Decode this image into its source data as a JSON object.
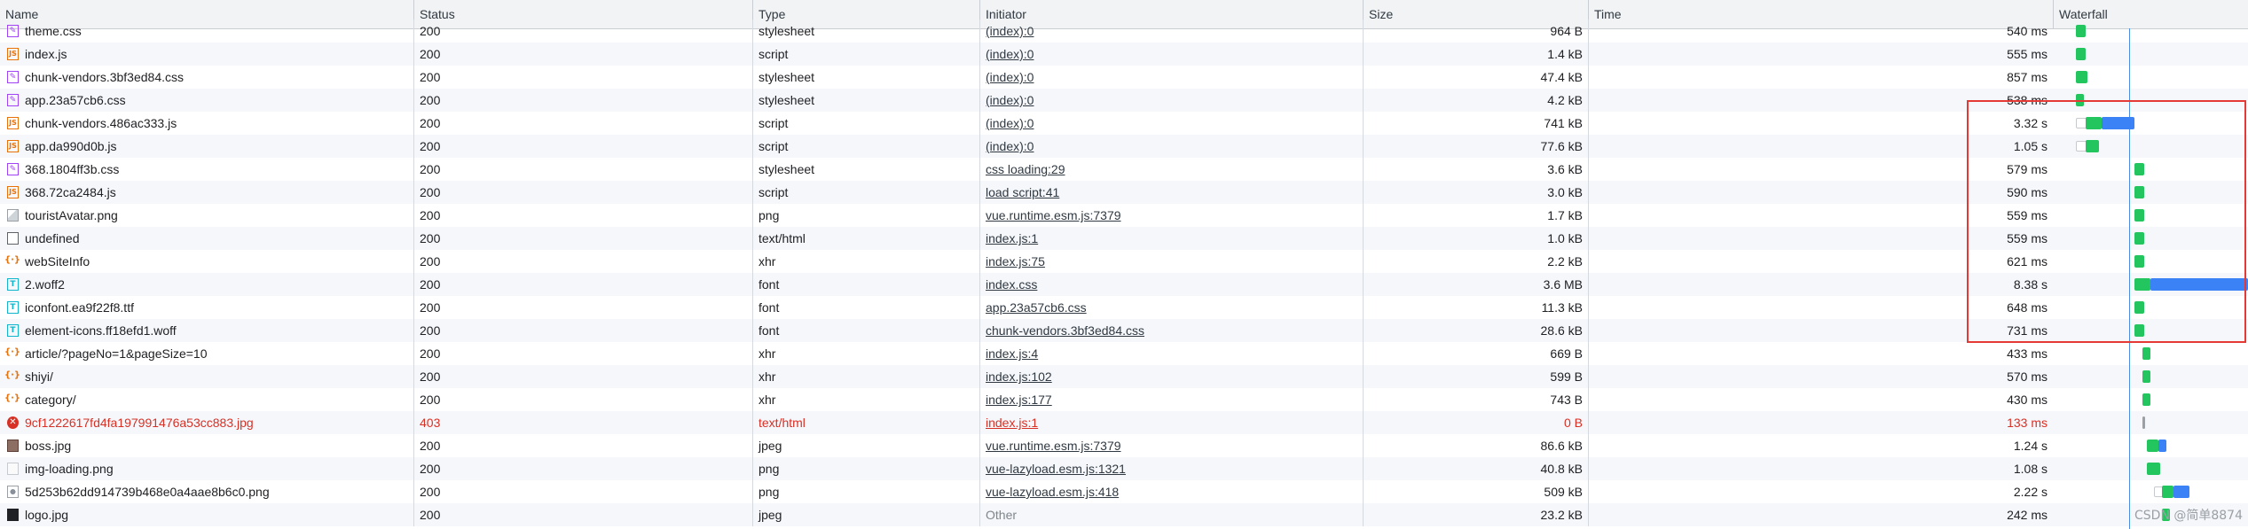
{
  "columns": [
    "Name",
    "Status",
    "Type",
    "Initiator",
    "Size",
    "Time",
    "Waterfall"
  ],
  "rows": [
    {
      "name": "theme.css",
      "status": "200",
      "type": "stylesheet",
      "initiator": "(index):0",
      "size": "964 B",
      "time": "540 ms",
      "icon": "css"
    },
    {
      "name": "index.js",
      "status": "200",
      "type": "script",
      "initiator": "(index):0",
      "size": "1.4 kB",
      "time": "555 ms",
      "icon": "script"
    },
    {
      "name": "chunk-vendors.3bf3ed84.css",
      "status": "200",
      "type": "stylesheet",
      "initiator": "(index):0",
      "size": "47.4 kB",
      "time": "857 ms",
      "icon": "css"
    },
    {
      "name": "app.23a57cb6.css",
      "status": "200",
      "type": "stylesheet",
      "initiator": "(index):0",
      "size": "4.2 kB",
      "time": "538 ms",
      "icon": "css"
    },
    {
      "name": "chunk-vendors.486ac333.js",
      "status": "200",
      "type": "script",
      "initiator": "(index):0",
      "size": "741 kB",
      "time": "3.32 s",
      "icon": "script"
    },
    {
      "name": "app.da990d0b.js",
      "status": "200",
      "type": "script",
      "initiator": "(index):0",
      "size": "77.6 kB",
      "time": "1.05 s",
      "icon": "script"
    },
    {
      "name": "368.1804ff3b.css",
      "status": "200",
      "type": "stylesheet",
      "initiator": "css loading:29",
      "size": "3.6 kB",
      "time": "579 ms",
      "icon": "css"
    },
    {
      "name": "368.72ca2484.js",
      "status": "200",
      "type": "script",
      "initiator": "load script:41",
      "size": "3.0 kB",
      "time": "590 ms",
      "icon": "script"
    },
    {
      "name": "touristAvatar.png",
      "status": "200",
      "type": "png",
      "initiator": "vue.runtime.esm.js:7379",
      "size": "1.7 kB",
      "time": "559 ms",
      "icon": "img"
    },
    {
      "name": "undefined",
      "status": "200",
      "type": "text/html",
      "initiator": "index.js:1",
      "size": "1.0 kB",
      "time": "559 ms",
      "icon": "doc"
    },
    {
      "name": "webSiteInfo",
      "status": "200",
      "type": "xhr",
      "initiator": "index.js:75",
      "size": "2.2 kB",
      "time": "621 ms",
      "icon": "xhr"
    },
    {
      "name": "2.woff2",
      "status": "200",
      "type": "font",
      "initiator": "index.css",
      "size": "3.6 MB",
      "time": "8.38 s",
      "icon": "font"
    },
    {
      "name": "iconfont.ea9f22f8.ttf",
      "status": "200",
      "type": "font",
      "initiator": "app.23a57cb6.css",
      "size": "11.3 kB",
      "time": "648 ms",
      "icon": "font"
    },
    {
      "name": "element-icons.ff18efd1.woff",
      "status": "200",
      "type": "font",
      "initiator": "chunk-vendors.3bf3ed84.css",
      "size": "28.6 kB",
      "time": "731 ms",
      "icon": "font"
    },
    {
      "name": "article/?pageNo=1&pageSize=10",
      "status": "200",
      "type": "xhr",
      "initiator": "index.js:4",
      "size": "669 B",
      "time": "433 ms",
      "icon": "xhr"
    },
    {
      "name": "shiyi/",
      "status": "200",
      "type": "xhr",
      "initiator": "index.js:102",
      "size": "599 B",
      "time": "570 ms",
      "icon": "xhr"
    },
    {
      "name": "category/",
      "status": "200",
      "type": "xhr",
      "initiator": "index.js:177",
      "size": "743 B",
      "time": "430 ms",
      "icon": "xhr"
    },
    {
      "name": "9cf1222617fd4fa197991476a53cc883.jpg",
      "status": "403",
      "type": "text/html",
      "initiator": "index.js:1",
      "size": "0 B",
      "time": "133 ms",
      "icon": "err",
      "error": true
    },
    {
      "name": "boss.jpg",
      "status": "200",
      "type": "jpeg",
      "initiator": "vue.runtime.esm.js:7379",
      "size": "86.6 kB",
      "time": "1.24 s",
      "icon": "jpg"
    },
    {
      "name": "img-loading.png",
      "status": "200",
      "type": "png",
      "initiator": "vue-lazyload.esm.js:1321",
      "size": "40.8 kB",
      "time": "1.08 s",
      "icon": "png"
    },
    {
      "name": "5d253b62dd914739b468e0a4aae8b6c0.png",
      "status": "200",
      "type": "png",
      "initiator": "vue-lazyload.esm.js:418",
      "size": "509 kB",
      "time": "2.22 s",
      "icon": "png2"
    },
    {
      "name": "logo.jpg",
      "status": "200",
      "type": "jpeg",
      "initiator": "Other",
      "size": "23.2 kB",
      "time": "242 ms",
      "icon": "dark",
      "muted_initiator": true
    }
  ],
  "waterfall": [
    {
      "start": 0.12,
      "ttfb": 0.05,
      "dl": 0.0
    },
    {
      "start": 0.12,
      "ttfb": 0.05,
      "dl": 0.0
    },
    {
      "start": 0.12,
      "ttfb": 0.06,
      "dl": 0.0
    },
    {
      "start": 0.12,
      "ttfb": 0.04,
      "dl": 0.0
    },
    {
      "start": 0.17,
      "ttfb": 0.08,
      "dl": 0.17,
      "wait": 0.05
    },
    {
      "start": 0.17,
      "ttfb": 0.07,
      "dl": 0.0,
      "wait": 0.05
    },
    {
      "start": 0.42,
      "ttfb": 0.05,
      "dl": 0.0
    },
    {
      "start": 0.42,
      "ttfb": 0.05,
      "dl": 0.0
    },
    {
      "start": 0.42,
      "ttfb": 0.05,
      "dl": 0.0
    },
    {
      "start": 0.42,
      "ttfb": 0.05,
      "dl": 0.0
    },
    {
      "start": 0.42,
      "ttfb": 0.05,
      "dl": 0.0
    },
    {
      "start": 0.42,
      "ttfb": 0.08,
      "dl": 0.5
    },
    {
      "start": 0.42,
      "ttfb": 0.05,
      "dl": 0.0
    },
    {
      "start": 0.42,
      "ttfb": 0.05,
      "dl": 0.0
    },
    {
      "start": 0.46,
      "ttfb": 0.04,
      "dl": 0.0
    },
    {
      "start": 0.46,
      "ttfb": 0.04,
      "dl": 0.0
    },
    {
      "start": 0.46,
      "ttfb": 0.04,
      "dl": 0.0
    },
    {
      "start": 0.46,
      "ttfb": 0.01,
      "dl": 0.0,
      "gray": true
    },
    {
      "start": 0.48,
      "ttfb": 0.06,
      "dl": 0.04
    },
    {
      "start": 0.48,
      "ttfb": 0.07,
      "dl": 0.0
    },
    {
      "start": 0.56,
      "ttfb": 0.06,
      "dl": 0.08,
      "wait": 0.04
    },
    {
      "start": 0.56,
      "ttfb": 0.04,
      "dl": 0.0
    }
  ],
  "watermark": "CSDN @简单8874"
}
